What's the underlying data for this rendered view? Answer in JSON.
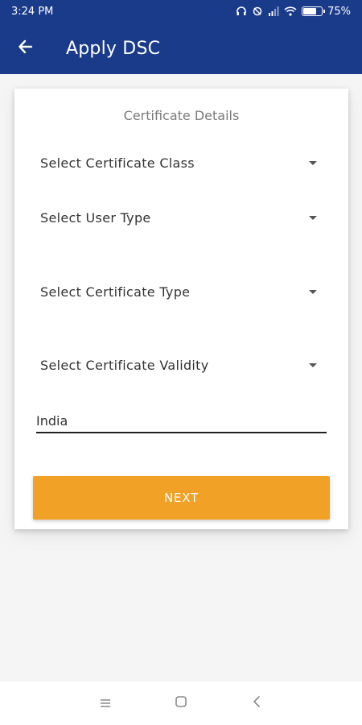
{
  "status_bar": {
    "time": "3:24 PM",
    "battery": "75%",
    "battery_level": 0.75,
    "icons": [
      "headphones-icon",
      "sync-icon",
      "signal-icon",
      "wifi-icon",
      "battery-icon"
    ]
  },
  "app_bar": {
    "title": "Apply DSC",
    "back_icon": "arrow-left-icon"
  },
  "card": {
    "title": "Certificate Details",
    "selects": [
      {
        "label": "Select Certificate Class"
      },
      {
        "label": "Select User Type"
      },
      {
        "label": "Select Certificate Type"
      },
      {
        "label": "Select Certificate Validity"
      }
    ],
    "country_field": {
      "value": "India"
    },
    "next_button": "NEXT"
  },
  "nav_bar": {
    "icons": [
      "menu-icon",
      "home-icon",
      "back-icon"
    ]
  },
  "colors": {
    "primary": "#1a3a8a",
    "accent": "#f0a126",
    "background": "#f5f5f5"
  }
}
